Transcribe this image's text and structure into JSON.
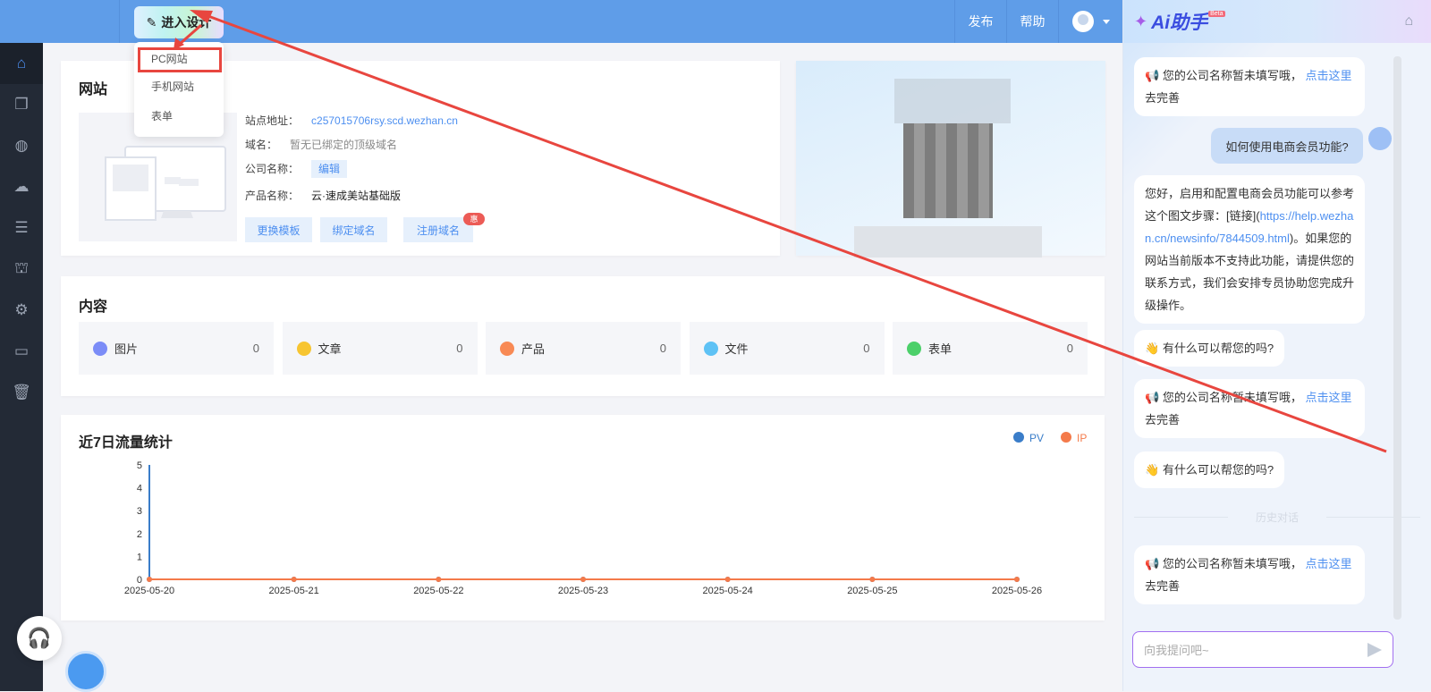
{
  "topbar": {
    "design_button": "进入设计",
    "publish": "发布",
    "help": "帮助"
  },
  "dropdown": [
    "PC网站",
    "手机网站",
    "表单"
  ],
  "sidebar": [
    "home-icon",
    "pages-icon",
    "planet-icon",
    "wechat-icon",
    "list-icon",
    "shop-icon",
    "settings-icon",
    "terminal-icon",
    "trash-icon"
  ],
  "website": {
    "title": "网站",
    "address_label": "站点地址：",
    "address": "c257015706rsy.scd.wezhan.cn",
    "domain_label": "域名：",
    "domain": "暂无已绑定的顶级域名",
    "company_label": "公司名称：",
    "company_edit": "编辑",
    "product_label": "产品名称：",
    "product": "云·速成美站基础版",
    "buttons": [
      "更换模板",
      "绑定域名",
      "注册域名"
    ],
    "badge": "惠"
  },
  "content": {
    "title": "内容",
    "tiles": [
      {
        "label": "图片",
        "count": "0",
        "color": "#7b8cf7"
      },
      {
        "label": "文章",
        "count": "0",
        "color": "#f7c531"
      },
      {
        "label": "产品",
        "count": "0",
        "color": "#f88a55"
      },
      {
        "label": "文件",
        "count": "0",
        "color": "#5ec2f5"
      },
      {
        "label": "表单",
        "count": "0",
        "color": "#4cd06a"
      }
    ]
  },
  "chart_data": {
    "type": "line",
    "title": "近7日流量统计",
    "categories": [
      "2025-05-20",
      "2025-05-21",
      "2025-05-22",
      "2025-05-23",
      "2025-05-24",
      "2025-05-25",
      "2025-05-26"
    ],
    "series": [
      {
        "name": "PV",
        "values": [
          0,
          0,
          0,
          0,
          0,
          0,
          0
        ],
        "color": "#3a7dc9"
      },
      {
        "name": "IP",
        "values": [
          0,
          0,
          0,
          0,
          0,
          0,
          0
        ],
        "color": "#f47a4a"
      }
    ],
    "yticks": [
      "0",
      "1",
      "2",
      "3",
      "4",
      "5"
    ],
    "ylim": [
      0,
      5
    ],
    "legend": "top-right"
  },
  "ai": {
    "title": "Ai助手",
    "beta": "Beta",
    "notice_text": "您的公司名称暂未填写哦，",
    "notice_link": "点击这里",
    "notice_tail": " 去完善",
    "user_question": "如何使用电商会员功能?",
    "answer_pre": "您好，启用和配置电商会员功能可以参考这个图文步骤：[链接](",
    "answer_link": "https://help.wezhan.cn/newsinfo/7844509.html",
    "answer_post": ")。如果您的网站当前版本不支持此功能，请提供您的联系方式，我们会安排专员协助您完成升级操作。",
    "greeting": "有什么可以帮您的吗?",
    "history": "历史对话",
    "input_placeholder": "向我提问吧~"
  }
}
